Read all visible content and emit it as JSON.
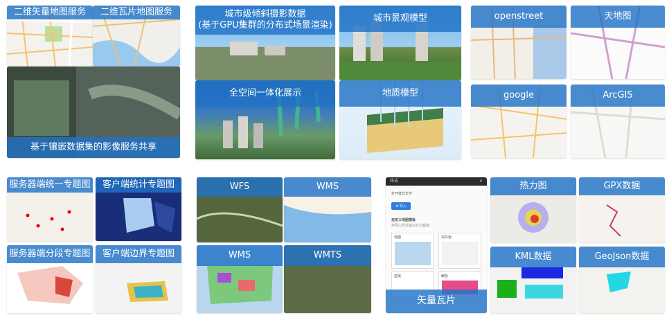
{
  "tiles": {
    "vector_map_service": "二维矢量地图服务",
    "tile_map_service": "二维瓦片地图服务",
    "mosaic_imagery_service": "基于镶嵌数据集的影像服务共享",
    "oblique_photo": "城市级倾斜摄影数据\n(基于GPU集群的分布式场景渲染)",
    "city_model": "城市景观模型",
    "integrated_view": "全空间一体化展示",
    "geology_model": "地质模型",
    "openstreet": "openstreet",
    "tianditu": "天地图",
    "google": "google",
    "arcgis": "ArcGIS",
    "server_thematic": "服务器端统一专题图",
    "client_stat_thematic": "客户端统计专题图",
    "server_range_thematic": "服务器端分段专题图",
    "client_border_thematic": "客户端边界专题图",
    "wfs": "WFS",
    "wms_top": "WMS",
    "wms_bottom": "WMS",
    "wmts": "WMTS",
    "vector_tile": "矢量瓦片",
    "heatmap": "热力图",
    "gpx": "GPX数据",
    "kml": "KML数据",
    "geojson": "GeoJson数据"
  },
  "panel": {
    "title": "样式",
    "close": "×",
    "open_label": "打开样式文件",
    "import_button": "⊕ 导入",
    "custom_label": "自定义地图模板",
    "custom_sub": "可导入样式或以此为基础",
    "cards": [
      "地图",
      "深灰色",
      "蓝黑",
      "暖色"
    ]
  },
  "colors": {
    "bar": "#2173c7",
    "accent": "#2a7de1"
  }
}
